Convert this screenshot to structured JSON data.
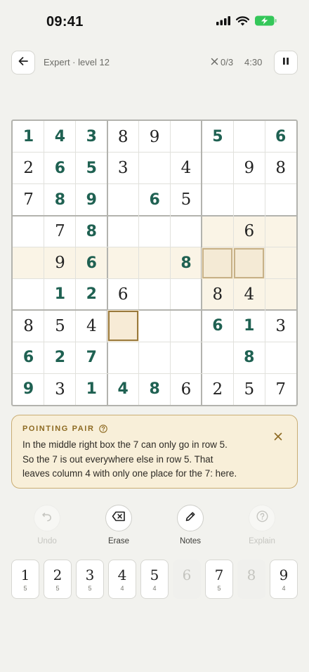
{
  "status_bar": {
    "time": "09:41"
  },
  "header": {
    "level": "Expert · level 12",
    "mistakes": "0/3",
    "timer": "4:30"
  },
  "board": {
    "givens": [
      "1 3 8 9   5   6",
      "2 6 5 3   4   9 8"
    ],
    "rows": [
      [
        "1",
        "4",
        "3",
        "8",
        "9",
        "",
        "5",
        "",
        "6"
      ],
      [
        "2",
        "6",
        "5",
        "3",
        "",
        "4",
        "",
        "9",
        "8"
      ],
      [
        "7",
        "8",
        "9",
        "",
        "6",
        "5",
        "",
        "",
        ""
      ],
      [
        "",
        "7",
        "8",
        "",
        "",
        "",
        "",
        "6",
        ""
      ],
      [
        "",
        "9",
        "6",
        "",
        "",
        "8",
        "",
        "",
        ""
      ],
      [
        "",
        "1",
        "2",
        "6",
        "",
        "",
        "8",
        "4",
        ""
      ],
      [
        "8",
        "5",
        "4",
        "",
        "",
        "",
        "6",
        "1",
        "3"
      ],
      [
        "6",
        "2",
        "7",
        "",
        "",
        "",
        "",
        "8",
        ""
      ],
      [
        "9",
        "3",
        "1",
        "4",
        "8",
        "6",
        "2",
        "5",
        "7"
      ]
    ],
    "user_cells": [
      "0-0",
      "0-1",
      "0-2",
      "0-6",
      "0-8",
      "1-1",
      "1-2",
      "2-1",
      "2-2",
      "2-4",
      "3-2",
      "4-2",
      "4-5",
      "5-1",
      "5-2",
      "6-6",
      "6-7",
      "7-0",
      "7-1",
      "7-2",
      "7-7",
      "8-0",
      "8-2",
      "8-3",
      "8-4"
    ],
    "peer_cells": [
      "3-6",
      "3-7",
      "3-8",
      "4-0",
      "4-1",
      "4-2",
      "4-3",
      "4-4",
      "4-5",
      "4-8",
      "5-6",
      "5-7",
      "5-8"
    ],
    "hint_cells": [
      "4-6",
      "4-7"
    ],
    "selected_cell": "6-3"
  },
  "hint": {
    "title": "POINTING PAIR",
    "lines": [
      "In the middle right box the 7 can only go in row 5.",
      "So the 7 is out everywhere else in row 5. That",
      "leaves column 4 with only one place for the 7: here."
    ]
  },
  "tools": {
    "undo": "Undo",
    "erase": "Erase",
    "notes": "Notes",
    "explain": "Explain"
  },
  "keypad": [
    {
      "digit": "1",
      "count": "5"
    },
    {
      "digit": "2",
      "count": "5"
    },
    {
      "digit": "3",
      "count": "5"
    },
    {
      "digit": "4",
      "count": "4"
    },
    {
      "digit": "5",
      "count": "4"
    },
    {
      "digit": "6",
      "count": ""
    },
    {
      "digit": "7",
      "count": "5"
    },
    {
      "digit": "8",
      "count": ""
    },
    {
      "digit": "9",
      "count": "4"
    }
  ],
  "colors": {
    "accent": "#1f6152",
    "hint_bg": "#f8efd9",
    "hint_border": "#c9ad73",
    "selected_border": "#9a7a3c"
  }
}
